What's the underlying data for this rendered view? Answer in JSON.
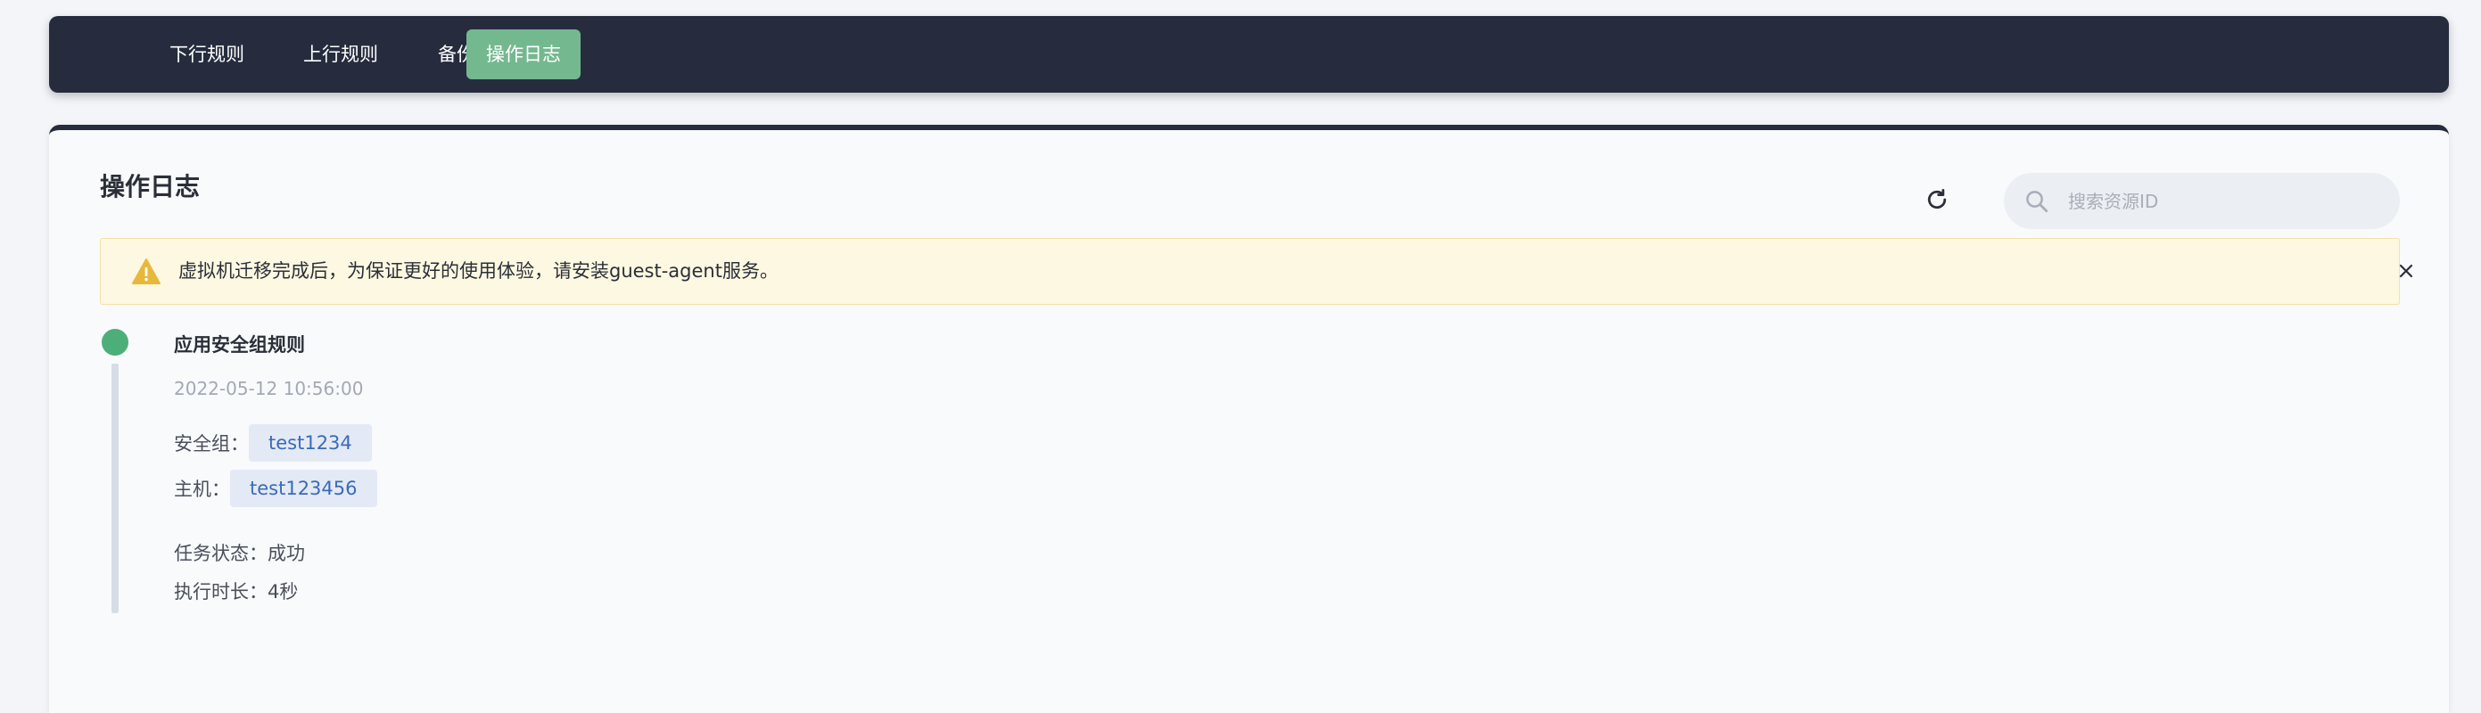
{
  "tabs": [
    {
      "label": "下行规则"
    },
    {
      "label": "上行规则"
    },
    {
      "label": "备份"
    },
    {
      "label": "操作日志",
      "active": true
    }
  ],
  "page": {
    "title": "操作日志"
  },
  "search": {
    "placeholder": "搜索资源ID",
    "value": ""
  },
  "alert": {
    "message": "虚拟机迁移完成后，为保证更好的使用体验，请安装guest-agent服务。"
  },
  "log_entry": {
    "title": "应用安全组规则",
    "timestamp": "2022-05-12 10:56:00",
    "security_group_label": "安全组：",
    "security_group_value": "test1234",
    "host_label": "主机：",
    "host_value": "test123456",
    "task_status_label": "任务状态：",
    "task_status_value": "成功",
    "duration_label": "执行时长：",
    "duration_value": "4秒"
  },
  "colors": {
    "topbar_bg": "#262c3e",
    "active_tab": "#74b890",
    "timeline_dot": "#4caf7a",
    "alert_bg": "#fdf8e1",
    "warning": "#e8b83a",
    "tag_bg": "#e3e9f5",
    "tag_text": "#3a6bb8"
  },
  "icons": {
    "refresh": "refresh-icon",
    "search": "search-icon",
    "warning": "warning-icon",
    "close": "close-icon"
  }
}
